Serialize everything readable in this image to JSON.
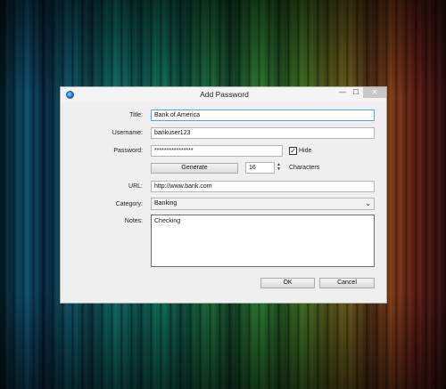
{
  "window": {
    "title": "Add Password",
    "controls": {
      "minimize": "—",
      "maximize": "☐",
      "close": "✕"
    }
  },
  "form": {
    "title_label": "Title:",
    "title_value": "Bank of America",
    "username_label": "Username:",
    "username_value": "bankuser123",
    "password_label": "Password:",
    "password_value": "****************",
    "hide_label": "Hide",
    "hide_checked": true,
    "generate_label": "Generate",
    "length_value": "16",
    "characters_label": "Characters",
    "url_label": "URL:",
    "url_value": "http://www.bank.com",
    "category_label": "Category:",
    "category_value": "Banking",
    "notes_label": "Notes:",
    "notes_value": "Checking"
  },
  "buttons": {
    "ok": "OK",
    "cancel": "Cancel"
  }
}
